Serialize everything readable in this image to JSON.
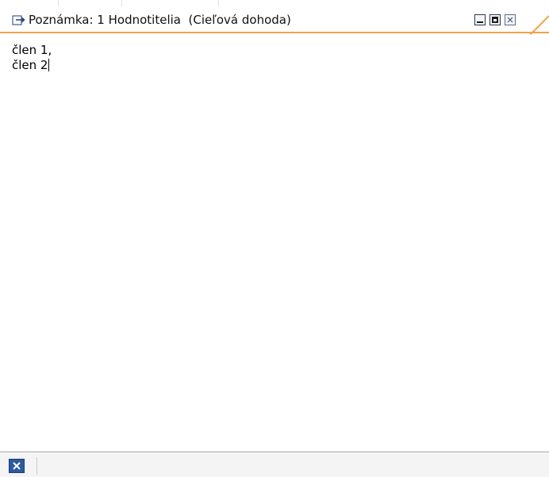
{
  "window": {
    "title": "Poznámka: 1 Hodnotitelia  (Cieľová dohoda)",
    "title_icon": "note-edit-icon",
    "buttons": {
      "minimize": "minimize-icon",
      "maximize": "maximize-icon",
      "close": "close-icon"
    },
    "accent_color": "#f0a44a"
  },
  "note": {
    "lines": [
      "člen 1,",
      "člen 2"
    ]
  },
  "statusbar": {
    "close_icon": "close-icon",
    "accent_color": "#2c5aa0"
  }
}
